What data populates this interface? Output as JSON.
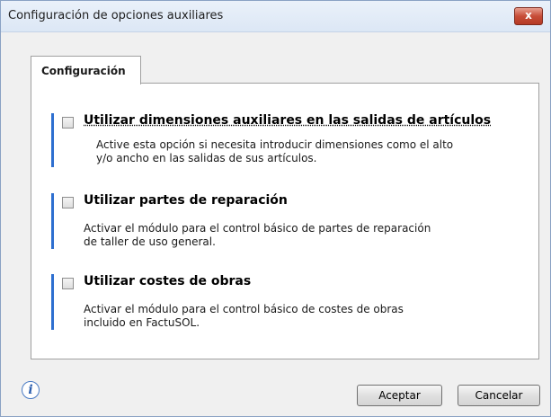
{
  "window": {
    "title": "Configuración de opciones auxiliares",
    "close_label": "x"
  },
  "tabs": [
    {
      "label": "Configuración",
      "active": true
    }
  ],
  "options": [
    {
      "checked": false,
      "title": "Utilizar dimensiones auxiliares en las salidas de artículos",
      "description_lines": [
        "Active esta opción si necesita introducir dimensiones como el alto",
        "y/o ancho en las salidas de sus artículos."
      ]
    },
    {
      "checked": false,
      "title": "Utilizar partes de reparación",
      "description_lines": [
        "Activar el módulo para el control básico de partes de reparación",
        "de taller de uso general."
      ]
    },
    {
      "checked": false,
      "title": "Utilizar costes de obras",
      "description_lines": [
        "Activar el módulo para el control básico de costes de obras",
        "incluido en FactuSOL."
      ]
    }
  ],
  "footer": {
    "info_glyph": "i",
    "accept_label": "Aceptar",
    "cancel_label": "Cancelar"
  },
  "colors": {
    "accent_bar": "#2e6fd0",
    "titlebar": "#dce7f5",
    "close_button": "#c74d38"
  }
}
